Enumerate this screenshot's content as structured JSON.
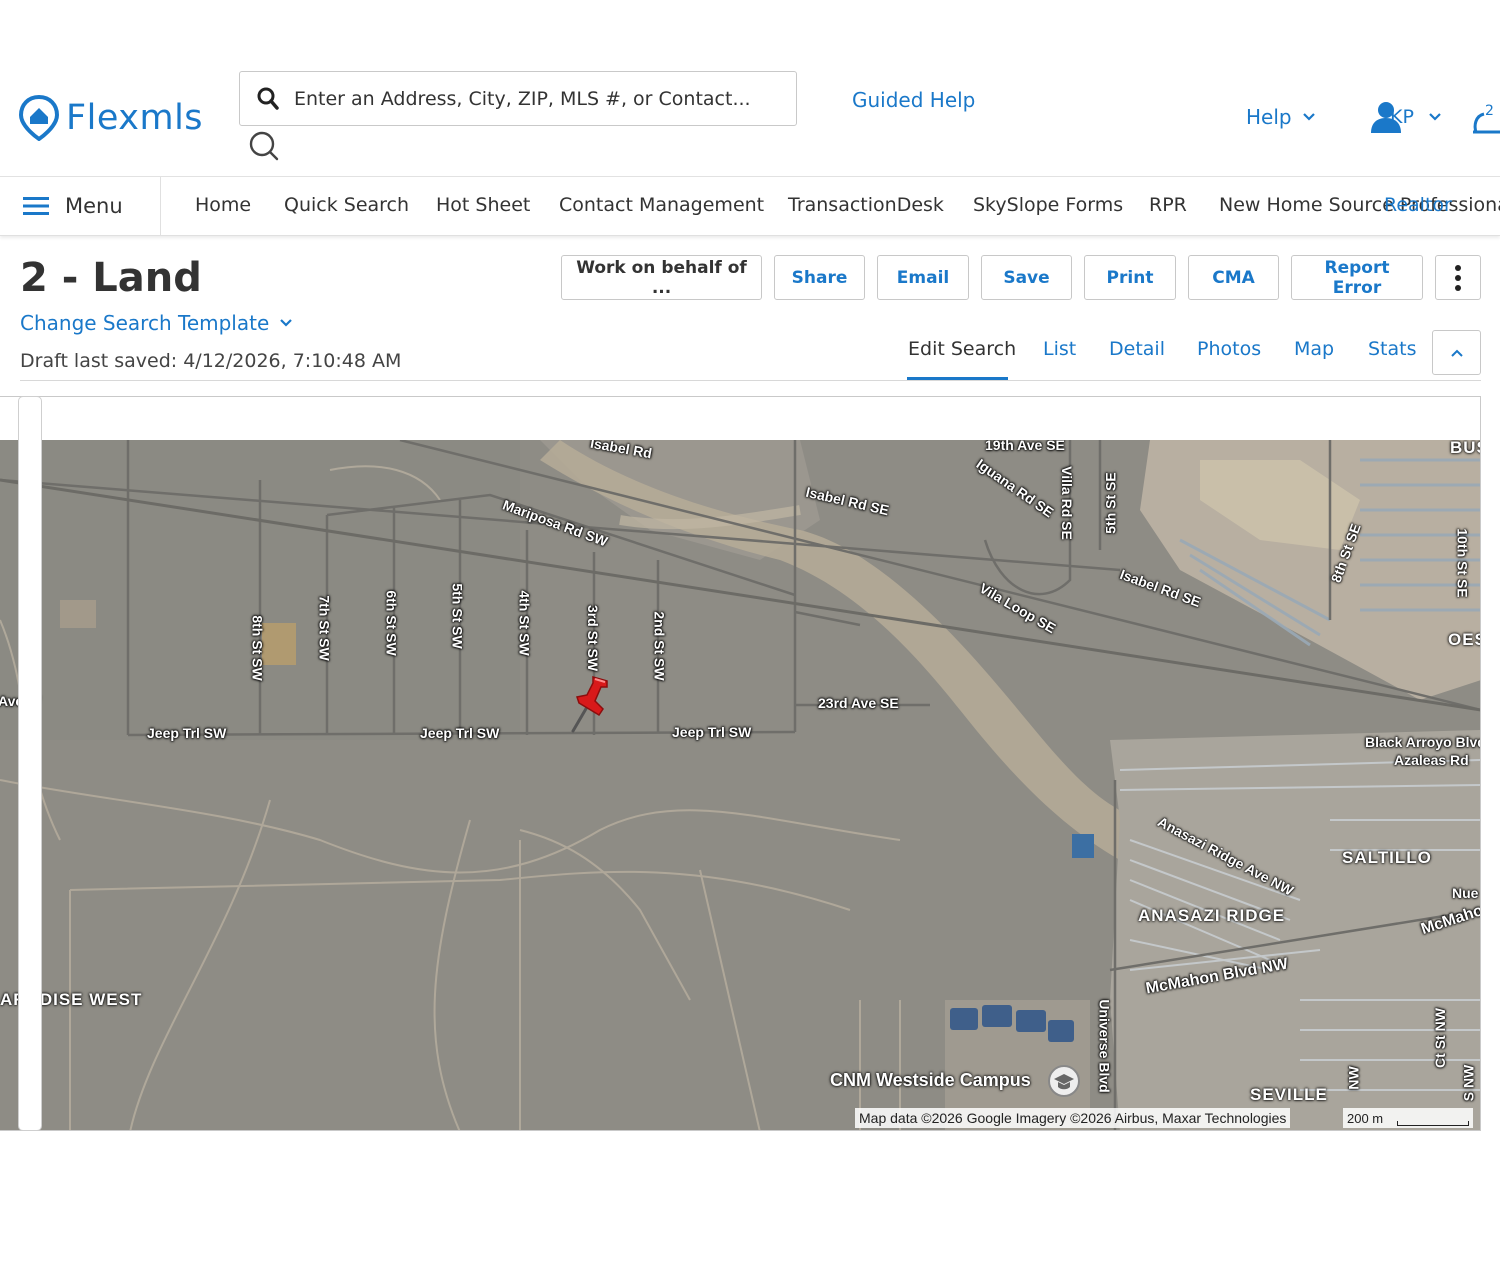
{
  "app": {
    "logo_text": "Flexmls"
  },
  "search": {
    "placeholder": "Enter an Address, City, ZIP, MLS #, or Contact..."
  },
  "header": {
    "guided_help": "Guided Help",
    "help": "Help",
    "user_initials": "KP",
    "notification_count": "2"
  },
  "nav": {
    "menu_label": "Menu",
    "items": [
      "Home",
      "Quick Search",
      "Hot Sheet",
      "Contact Management",
      "TransactionDesk",
      "SkySlope Forms",
      "RPR",
      "New Home Source Professional",
      "Realtor"
    ]
  },
  "page": {
    "title": "2 - Land",
    "change_template": "Change Search Template",
    "draft_saved": "Draft last saved: 4/12/2026, 7:10:48 AM"
  },
  "actions": {
    "work_on_behalf": "Work on behalf of ...",
    "share": "Share",
    "email": "Email",
    "save": "Save",
    "print": "Print",
    "cma": "CMA",
    "report_error": "Report Error"
  },
  "tabs": {
    "edit_search": "Edit Search",
    "list": "List",
    "detail": "Detail",
    "photos": "Photos",
    "map": "Map",
    "stats": "Stats",
    "active": "Edit Search"
  },
  "map": {
    "streets": {
      "isabel_rd_top": "Isabel Rd",
      "isabel_rd_se_1": "Isabel Rd SE",
      "isabel_rd_se_2": "Isabel Rd SE",
      "mariposa": "Mariposa Rd SW",
      "st19": "19th Ave SE",
      "iguana": "Iguana Rd SE",
      "villa": "Villa Rd SE",
      "st5se": "5th St SE",
      "vila_loop": "Vila Loop SE",
      "st8se": "8th St SE",
      "st10se": "10th St SE",
      "st8sw": "8th St SW",
      "st7sw": "7th St SW",
      "st6sw": "6th St SW",
      "st5sw": "5th St SW",
      "st4sw": "4th St SW",
      "st3sw": "3rd St SW",
      "st2sw": "2nd St SW",
      "ave_w": "Ave W",
      "jeep1": "Jeep Trl SW",
      "jeep2": "Jeep Trl SW",
      "jeep3": "Jeep Trl SW",
      "ave23": "23rd Ave SE",
      "black_arroyo": "Black Arroyo Blvd",
      "azaleas": "Azaleas Rd",
      "anasazi_ave": "Anasazi Ridge Ave NW",
      "mcmahon": "McMahon Blvd NW",
      "mcmahon_right": "McMahon",
      "universe": "Universe Blvd",
      "nue": "Nue",
      "nw": "NW",
      "st_nw": "Ct St NW",
      "s_nw": "S NW"
    },
    "places": {
      "bus": "BUS",
      "oes": "OES",
      "saltillo": "SALTILLO",
      "anasazi_ridge": "ANASAZI RIDGE",
      "paradise_west": "ARADISE WEST",
      "seville": "SEVILLE",
      "cnm": "CNM Westside Campus"
    },
    "attribution": "Map data ©2026 Google Imagery ©2026 Airbus, Maxar Technologies",
    "scale": "200 m",
    "marker": "pushpin-marker"
  },
  "colors": {
    "brand": "#1a78c9",
    "marker": "#d8191a"
  }
}
